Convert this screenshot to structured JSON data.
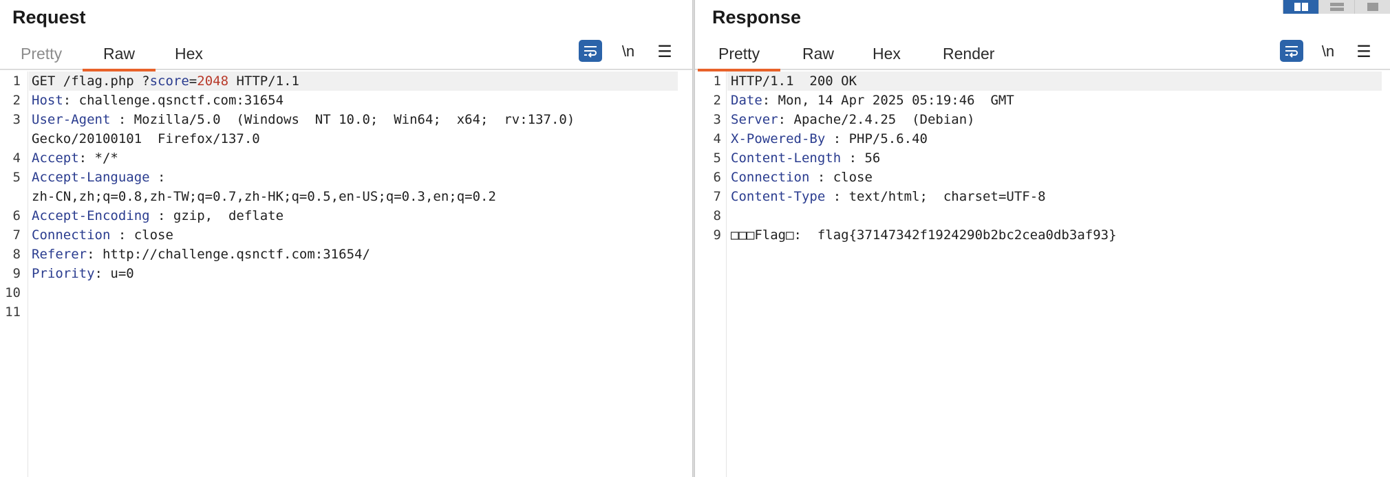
{
  "request": {
    "title": "Request",
    "tabs": [
      {
        "label": "Pretty",
        "state": "dim"
      },
      {
        "label": "Raw",
        "state": "active"
      },
      {
        "label": "Hex",
        "state": "normal"
      }
    ],
    "newline_label": "\\n",
    "menu_glyph": "☰",
    "line_numbers": [
      "1",
      "2",
      "3",
      "",
      "4",
      "5",
      "",
      "6",
      "7",
      "8",
      "9",
      "10",
      "11"
    ],
    "lines": [
      {
        "parts": [
          [
            "GET /flag.php ?",
            ""
          ],
          [
            "score",
            "param"
          ],
          [
            "=",
            ""
          ],
          [
            "2048",
            "val"
          ],
          [
            " HTTP/1.1",
            ""
          ]
        ]
      },
      {
        "parts": [
          [
            "Host",
            "key"
          ],
          [
            ": challenge.qsnctf.com:31654",
            ""
          ]
        ]
      },
      {
        "parts": [
          [
            "User-Agent",
            "key"
          ],
          [
            " : Mozilla/5.0  (Windows  NT 10.0;  Win64;  x64;  rv:137.0)",
            ""
          ]
        ]
      },
      {
        "parts": [
          [
            "Gecko/20100101  Firefox/137.0",
            ""
          ]
        ]
      },
      {
        "parts": [
          [
            "Accept",
            "key"
          ],
          [
            ": */*",
            ""
          ]
        ]
      },
      {
        "parts": [
          [
            "Accept-Language",
            "key"
          ],
          [
            " :",
            ""
          ]
        ]
      },
      {
        "parts": [
          [
            "zh-CN,zh;q=0.8,zh-TW;q=0.7,zh-HK;q=0.5,en-US;q=0.3,en;q=0.2",
            ""
          ]
        ]
      },
      {
        "parts": [
          [
            "Accept-Encoding",
            "key"
          ],
          [
            " : gzip,  deflate",
            ""
          ]
        ]
      },
      {
        "parts": [
          [
            "Connection",
            "key"
          ],
          [
            " : close",
            ""
          ]
        ]
      },
      {
        "parts": [
          [
            "Referer",
            "key"
          ],
          [
            ": http://challenge.qsnctf.com:31654/",
            ""
          ]
        ]
      },
      {
        "parts": [
          [
            "Priority",
            "key"
          ],
          [
            ": u=0",
            ""
          ]
        ]
      },
      {
        "parts": [
          [
            "",
            ""
          ]
        ]
      },
      {
        "parts": [
          [
            "",
            ""
          ]
        ]
      }
    ]
  },
  "response": {
    "title": "Response",
    "tabs": [
      {
        "label": "Pretty",
        "state": "active"
      },
      {
        "label": "Raw",
        "state": "normal"
      },
      {
        "label": "Hex",
        "state": "normal"
      },
      {
        "label": "Render",
        "state": "normal"
      }
    ],
    "newline_label": "\\n",
    "menu_glyph": "☰",
    "line_numbers": [
      "1",
      "2",
      "3",
      "4",
      "5",
      "6",
      "7",
      "8",
      "9"
    ],
    "lines": [
      {
        "parts": [
          [
            "HTTP/1.1  200 OK",
            ""
          ]
        ]
      },
      {
        "parts": [
          [
            "Date",
            "key"
          ],
          [
            ": Mon, 14 Apr 2025 05:19:46  GMT",
            ""
          ]
        ]
      },
      {
        "parts": [
          [
            "Server",
            "key"
          ],
          [
            ": Apache/2.4.25  (Debian)",
            ""
          ]
        ]
      },
      {
        "parts": [
          [
            "X-Powered-By",
            "key"
          ],
          [
            " : PHP/5.6.40",
            ""
          ]
        ]
      },
      {
        "parts": [
          [
            "Content-Length",
            "key"
          ],
          [
            " : 56",
            ""
          ]
        ]
      },
      {
        "parts": [
          [
            "Connection",
            "key"
          ],
          [
            " : close",
            ""
          ]
        ]
      },
      {
        "parts": [
          [
            "Content-Type",
            "key"
          ],
          [
            " : text/html;  charset=UTF-8",
            ""
          ]
        ]
      },
      {
        "parts": [
          [
            "",
            ""
          ]
        ]
      },
      {
        "parts": [
          [
            "□□□Flag□:  flag{37147342f1924290b2bc2cea0db3af93}",
            ""
          ]
        ]
      }
    ]
  },
  "view_toggles": [
    {
      "icon": "split-view-icon",
      "active": true
    },
    {
      "icon": "horizontal-view-icon",
      "active": false
    },
    {
      "icon": "single-view-icon",
      "active": false
    }
  ],
  "colors": {
    "accent": "#e8622a",
    "button_blue": "#2b63a9",
    "header_key": "#2a3c8f",
    "value_red": "#b83a2a"
  }
}
